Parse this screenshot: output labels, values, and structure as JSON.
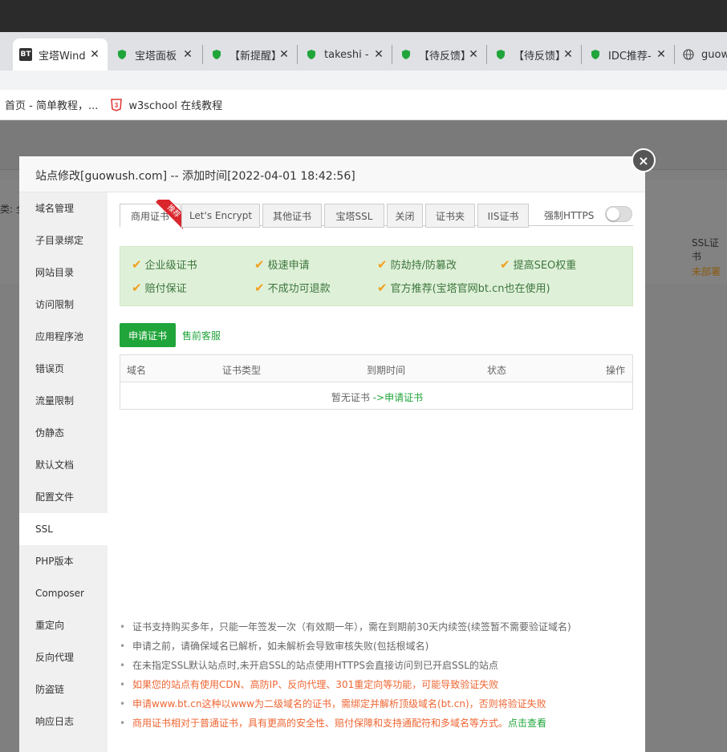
{
  "browser": {
    "tabs": [
      {
        "title": "宝塔Wind",
        "icon": "bt-icon",
        "active": true
      },
      {
        "title": "宝塔面板",
        "icon": "shield-icon"
      },
      {
        "title": "【新提醒】",
        "icon": "shield-icon"
      },
      {
        "title": "takeshi -",
        "icon": "shield-icon"
      },
      {
        "title": "【待反馈】",
        "icon": "shield-icon"
      },
      {
        "title": "【待反馈】",
        "icon": "shield-icon"
      },
      {
        "title": "IDC推荐-",
        "icon": "shield-icon"
      },
      {
        "title": "guow",
        "icon": "globe-icon"
      }
    ],
    "bookmarks": [
      {
        "label": "首页 - 简单教程，..."
      },
      {
        "label": "w3school 在线教程",
        "icon": "w3school-icon"
      }
    ]
  },
  "background": {
    "left_label": "类: 全",
    "ssl_header": "SSL证书",
    "ssl_status": "未部署"
  },
  "modal": {
    "title": "站点修改[guowush.com] -- 添加时间[2022-04-01 18:42:56]",
    "close_icon": "×",
    "nav": [
      "域名管理",
      "子目录绑定",
      "网站目录",
      "访问限制",
      "应用程序池",
      "错误页",
      "流量限制",
      "伪静态",
      "默认文档",
      "配置文件",
      "SSL",
      "PHP版本",
      "Composer",
      "重定向",
      "反向代理",
      "防盗链",
      "响应日志"
    ],
    "active_nav": "SSL",
    "tabs": [
      "商用证书",
      "Let's Encrypt",
      "其他证书",
      "宝塔SSL",
      "关闭",
      "证书夹",
      "IIS证书"
    ],
    "ribbon": "推荐",
    "force_https_label": "强制HTTPS",
    "force_https_on": false,
    "features": [
      "企业级证书",
      "极速申请",
      "防劫持/防篡改",
      "提高SEO权重",
      "赔付保证",
      "不成功可退款",
      "官方推荐(宝塔官网bt.cn也在使用)"
    ],
    "apply_button": "申请证书",
    "presale_link": "售前客服",
    "table": {
      "headers": [
        "域名",
        "证书类型",
        "到期时间",
        "状态",
        "操作"
      ],
      "empty_text": "暂无证书",
      "empty_link": "->申请证书"
    },
    "notes": [
      {
        "text": "证书支持购买多年，只能一年签发一次（有效期一年），需在到期前30天内续签(续签暂不需要验证域名)",
        "red": false
      },
      {
        "text": "申请之前，请确保域名已解析，如未解析会导致审核失败(包括根域名)",
        "red": false
      },
      {
        "text": "在未指定SSL默认站点时,未开启SSL的站点使用HTTPS会直接访问到已开启SSL的站点",
        "red": false
      },
      {
        "text": "如果您的站点有使用CDN、高防IP、反向代理、301重定向等功能，可能导致验证失败",
        "red": true
      },
      {
        "text": "申请www.bt.cn这种以www为二级域名的证书，需绑定并解析顶级域名(bt.cn)，否则将验证失败",
        "red": true
      },
      {
        "text": "商用证书相对于普通证书，具有更高的安全性、赔付保障和支持通配符和多域名等方式。",
        "red": true,
        "link": "点击查看"
      }
    ]
  },
  "colors": {
    "accent": "#20a53a",
    "warning": "#e63"
  }
}
